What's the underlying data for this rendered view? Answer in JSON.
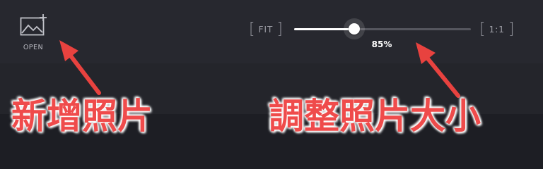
{
  "toolbar": {
    "open": {
      "label": "OPEN",
      "icon": "image-add-icon"
    },
    "fit_button": {
      "label": "FIT"
    },
    "actual_size_button": {
      "label": "1:1"
    },
    "zoom": {
      "value": 85,
      "readout": "85%"
    }
  },
  "annotations": {
    "left_caption": "新增照片",
    "right_caption": "調整照片大小",
    "arrow_color": "#e8423f"
  },
  "colors": {
    "toolbar_bg": "#27282f",
    "accent": "#ffffff",
    "caption": "#ef4b4b"
  }
}
